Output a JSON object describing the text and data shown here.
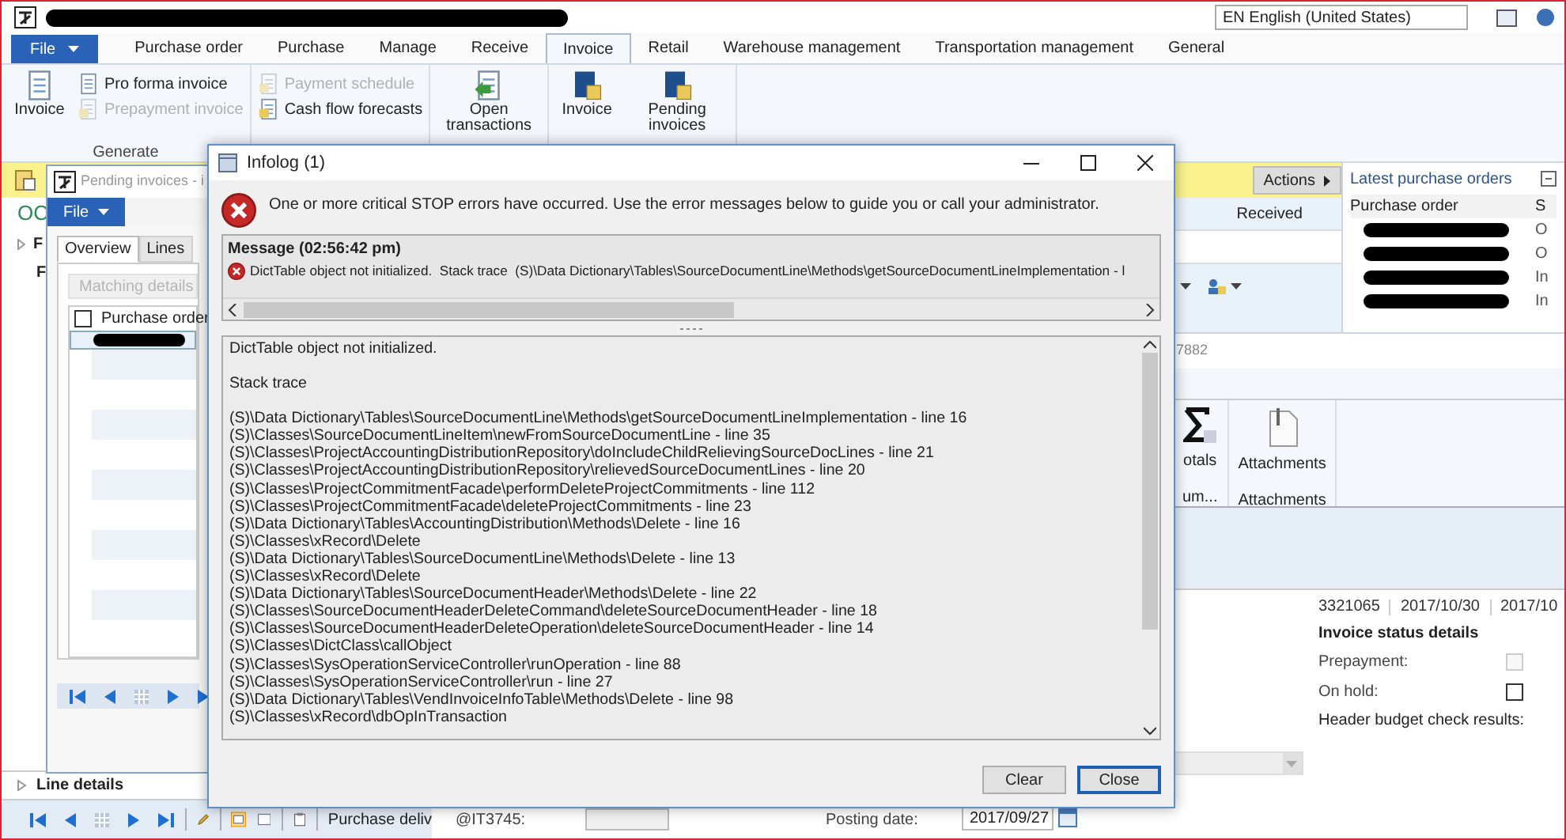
{
  "app": {
    "language": "EN English (United States)"
  },
  "ribbon_tabs": [
    {
      "label": "File",
      "kind": "file"
    },
    {
      "label": "Purchase order",
      "kind": "tab",
      "selected": false
    },
    {
      "label": "Purchase",
      "kind": "tab",
      "selected": false
    },
    {
      "label": "Manage",
      "kind": "tab",
      "selected": false
    },
    {
      "label": "Receive",
      "kind": "tab",
      "selected": false
    },
    {
      "label": "Invoice",
      "kind": "tab",
      "selected": true
    },
    {
      "label": "Retail",
      "kind": "tab",
      "selected": false
    },
    {
      "label": "Warehouse management",
      "kind": "tab",
      "selected": false
    },
    {
      "label": "Transportation management",
      "kind": "tab",
      "selected": false
    },
    {
      "label": "General",
      "kind": "tab",
      "selected": false
    }
  ],
  "ribbon_groups": [
    {
      "label": "Generate",
      "items": [
        {
          "label": "Invoice",
          "kind": "large",
          "disabled": false
        },
        {
          "label": "Pro forma invoice",
          "kind": "small",
          "disabled": false
        },
        {
          "label": "Prepayment invoice",
          "kind": "small",
          "disabled": true
        }
      ]
    },
    {
      "items": [
        {
          "label": "Payment schedule",
          "kind": "small",
          "disabled": true
        },
        {
          "label": "Cash flow forecasts",
          "kind": "small",
          "disabled": false
        }
      ]
    },
    {
      "items": [
        {
          "label": "Open transactions",
          "kind": "large",
          "disabled": false
        }
      ]
    },
    {
      "items": [
        {
          "label": "Invoice",
          "kind": "large",
          "disabled": false
        },
        {
          "label": "Pending invoices",
          "kind": "large",
          "disabled": false
        }
      ]
    }
  ],
  "form": {
    "title_fragment": "OC",
    "sections": [
      {
        "label": "F",
        "kind": "expander"
      },
      {
        "label": "F",
        "kind": "label"
      }
    ],
    "actions": "Actions",
    "received_header": "Received",
    "latest_orders": {
      "title": "Latest purchase orders",
      "columns": [
        "Purchase order",
        "S"
      ],
      "status_cells": [
        "O",
        "O",
        "In",
        "In"
      ]
    },
    "record_fragment": "7882",
    "fact_buttons": [
      {
        "label": "otals",
        "group": "um...",
        "kind": "sigma"
      },
      {
        "label": "Attachments",
        "group": "Attachments",
        "kind": "attachment"
      }
    ],
    "summary_row": [
      "3321065",
      "2017/10/30",
      "2017/10"
    ],
    "status_details": {
      "title": "Invoice status details",
      "fields": [
        {
          "label": "Prepayment:",
          "checked": false,
          "disabled": true
        },
        {
          "label": "On hold:",
          "checked": false,
          "disabled": false
        }
      ],
      "budget_label": "Header budget check results:"
    },
    "line_details": {
      "label": "Line details",
      "expanded": false
    },
    "bottom": {
      "purchase_delivery": "Purchase deliv",
      "field_label": "@IT3745:",
      "posting_label": "Posting date:",
      "posting_date": "2017/09/27"
    }
  },
  "pending_window": {
    "title": "Pending invoices - i",
    "file": "File",
    "tabs": [
      {
        "label": "Overview",
        "selected": true
      },
      {
        "label": "Lines",
        "selected": false
      }
    ],
    "matching_button": {
      "label": "Matching details",
      "disabled": true
    },
    "grid_header": {
      "label": "Purchase order",
      "checked": false
    }
  },
  "infolog": {
    "title": "Infolog (1)",
    "intro": "One or more critical STOP errors have occurred. Use the error messages below to guide you or call your administrator.",
    "message_header": "Message (02:56:42 pm)",
    "messages": [
      {
        "kind": "error",
        "text": "DictTable object not initialized.  Stack trace  (S)\\Data Dictionary\\Tables\\SourceDocumentLine\\Methods\\getSourceDocumentLineImplementation - l"
      }
    ],
    "detail": {
      "summary": "DictTable object not initialized.",
      "heading": "Stack trace",
      "frames": [
        "(S)\\Data Dictionary\\Tables\\SourceDocumentLine\\Methods\\getSourceDocumentLineImplementation - line 16",
        "(S)\\Classes\\SourceDocumentLineItem\\newFromSourceDocumentLine - line 35",
        "(S)\\Classes\\ProjectAccountingDistributionRepository\\doIncludeChildRelievingSourceDocLines - line 21",
        "(S)\\Classes\\ProjectAccountingDistributionRepository\\relievedSourceDocumentLines - line 20",
        "(S)\\Classes\\ProjectCommitmentFacade\\performDeleteProjectCommitments - line 112",
        "(S)\\Classes\\ProjectCommitmentFacade\\deleteProjectCommitments - line 23",
        "(S)\\Data Dictionary\\Tables\\AccountingDistribution\\Methods\\Delete - line 16",
        "(S)\\Classes\\xRecord\\Delete",
        "(S)\\Data Dictionary\\Tables\\SourceDocumentLine\\Methods\\Delete - line 13",
        "(S)\\Classes\\xRecord\\Delete",
        "(S)\\Data Dictionary\\Tables\\SourceDocumentHeader\\Methods\\Delete - line 22",
        "(S)\\Classes\\SourceDocumentHeaderDeleteCommand\\deleteSourceDocumentHeader - line 18",
        "(S)\\Classes\\SourceDocumentHeaderDeleteOperation\\deleteSourceDocumentHeader - line 14",
        "(S)\\Classes\\DictClass\\callObject",
        "(S)\\Classes\\SysOperationServiceController\\runOperation - line 88",
        "(S)\\Classes\\SysOperationServiceController\\run - line 27",
        "(S)\\Data Dictionary\\Tables\\VendInvoiceInfoTable\\Methods\\Delete - line 98",
        "(S)\\Classes\\xRecord\\dbOpInTransaction"
      ]
    },
    "buttons": [
      {
        "label": "Clear",
        "default": false
      },
      {
        "label": "Close",
        "default": true
      }
    ]
  }
}
